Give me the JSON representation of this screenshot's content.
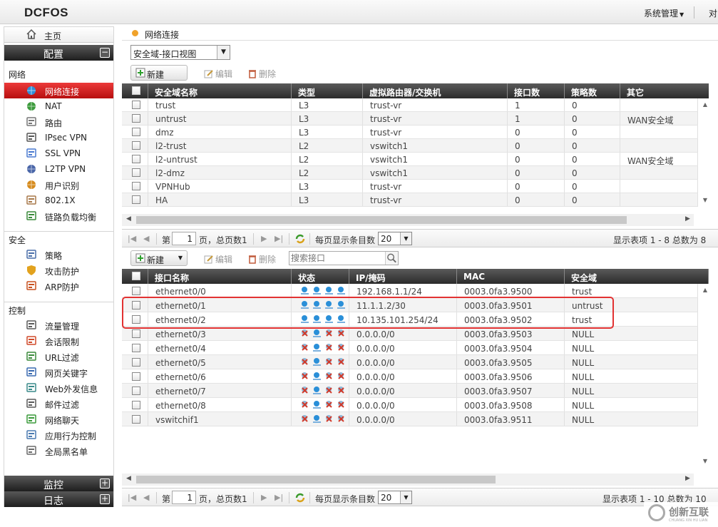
{
  "topbar": {
    "logo": "DCFOS",
    "system_menu": "系统管理",
    "truncated": "对"
  },
  "sidebar": {
    "home_label": "主页",
    "config_label": "配置",
    "config_toggle": "−",
    "sections": {
      "network": "网络",
      "security": "安全",
      "control": "控制"
    },
    "network_items": [
      {
        "label": "网络连接",
        "icon": "globe-icon"
      },
      {
        "label": "NAT",
        "icon": "nat-icon"
      },
      {
        "label": "路由",
        "icon": "route-icon"
      },
      {
        "label": "IPsec VPN",
        "icon": "ipsec-icon"
      },
      {
        "label": "SSL VPN",
        "icon": "ssl-icon"
      },
      {
        "label": "L2TP VPN",
        "icon": "l2tp-icon"
      },
      {
        "label": "用户识别",
        "icon": "user-id-icon"
      },
      {
        "label": "802.1X",
        "icon": "dot1x-icon"
      },
      {
        "label": "链路负载均衡",
        "icon": "lb-icon"
      }
    ],
    "security_items": [
      {
        "label": "策略",
        "icon": "policy-icon"
      },
      {
        "label": "攻击防护",
        "icon": "shield-icon"
      },
      {
        "label": "ARP防护",
        "icon": "arp-icon"
      }
    ],
    "control_items": [
      {
        "label": "流量管理",
        "icon": "traffic-icon"
      },
      {
        "label": "会话限制",
        "icon": "session-icon"
      },
      {
        "label": "URL过滤",
        "icon": "url-icon"
      },
      {
        "label": "网页关键字",
        "icon": "keyword-icon"
      },
      {
        "label": "Web外发信息",
        "icon": "web-out-icon"
      },
      {
        "label": "邮件过滤",
        "icon": "mail-icon"
      },
      {
        "label": "网络聊天",
        "icon": "chat-icon"
      },
      {
        "label": "应用行为控制",
        "icon": "app-icon"
      },
      {
        "label": "全局黑名单",
        "icon": "blacklist-icon"
      }
    ],
    "monitor_label": "监控",
    "log_label": "日志",
    "expand_symbol": "+"
  },
  "breadcrumb": {
    "label": "网络连接"
  },
  "view_select": {
    "value": "安全域-接口视图"
  },
  "zone_toolbar": {
    "new_label": "新建",
    "edit_label": "编辑",
    "delete_label": "删除"
  },
  "zone_table": {
    "headers": [
      "安全域名称",
      "类型",
      "虚拟路由器/交换机",
      "接口数",
      "策略数",
      "其它"
    ],
    "rows": [
      [
        "trust",
        "L3",
        "trust-vr",
        "1",
        "0",
        ""
      ],
      [
        "untrust",
        "L3",
        "trust-vr",
        "1",
        "0",
        "WAN安全域"
      ],
      [
        "dmz",
        "L3",
        "trust-vr",
        "0",
        "0",
        ""
      ],
      [
        "l2-trust",
        "L2",
        "vswitch1",
        "0",
        "0",
        ""
      ],
      [
        "l2-untrust",
        "L2",
        "vswitch1",
        "0",
        "0",
        "WAN安全域"
      ],
      [
        "l2-dmz",
        "L2",
        "vswitch1",
        "0",
        "0",
        ""
      ],
      [
        "VPNHub",
        "L3",
        "trust-vr",
        "0",
        "0",
        ""
      ],
      [
        "HA",
        "L3",
        "trust-vr",
        "0",
        "0",
        ""
      ]
    ]
  },
  "pager1": {
    "page_prefix": "第",
    "page_value": "1",
    "page_suffix": "页，总页数1",
    "per_page_label": "每页显示条目数",
    "per_page_value": "20",
    "info": "显示表项 1 - 8 总数为 8"
  },
  "iface_toolbar": {
    "new_label": "新建",
    "edit_label": "编辑",
    "delete_label": "删除",
    "search_placeholder": "搜索接口"
  },
  "iface_table": {
    "headers": [
      "接口名称",
      "状态",
      "IP/掩码",
      "MAC",
      "安全域"
    ],
    "rows": [
      {
        "name": "ethernet0/0",
        "status": [
          "up",
          "up",
          "up",
          "up"
        ],
        "ip": "192.168.1.1/24",
        "mac": "0003.0fa3.9500",
        "zone": "trust"
      },
      {
        "name": "ethernet0/1",
        "status": [
          "up",
          "up",
          "up",
          "up"
        ],
        "ip": "11.1.1.2/30",
        "mac": "0003.0fa3.9501",
        "zone": "untrust"
      },
      {
        "name": "ethernet0/2",
        "status": [
          "up",
          "up",
          "up",
          "up"
        ],
        "ip": "10.135.101.254/24",
        "mac": "0003.0fa3.9502",
        "zone": "trust"
      },
      {
        "name": "ethernet0/3",
        "status": [
          "down",
          "up",
          "down",
          "down"
        ],
        "ip": "0.0.0.0/0",
        "mac": "0003.0fa3.9503",
        "zone": "NULL"
      },
      {
        "name": "ethernet0/4",
        "status": [
          "down",
          "up",
          "down",
          "down"
        ],
        "ip": "0.0.0.0/0",
        "mac": "0003.0fa3.9504",
        "zone": "NULL"
      },
      {
        "name": "ethernet0/5",
        "status": [
          "down",
          "up",
          "down",
          "down"
        ],
        "ip": "0.0.0.0/0",
        "mac": "0003.0fa3.9505",
        "zone": "NULL"
      },
      {
        "name": "ethernet0/6",
        "status": [
          "down",
          "up",
          "down",
          "down"
        ],
        "ip": "0.0.0.0/0",
        "mac": "0003.0fa3.9506",
        "zone": "NULL"
      },
      {
        "name": "ethernet0/7",
        "status": [
          "down",
          "up",
          "down",
          "down"
        ],
        "ip": "0.0.0.0/0",
        "mac": "0003.0fa3.9507",
        "zone": "NULL"
      },
      {
        "name": "ethernet0/8",
        "status": [
          "down",
          "up",
          "down",
          "down"
        ],
        "ip": "0.0.0.0/0",
        "mac": "0003.0fa3.9508",
        "zone": "NULL"
      },
      {
        "name": "vswitchif1",
        "status": [
          "down",
          "up",
          "down",
          "down"
        ],
        "ip": "0.0.0.0/0",
        "mac": "0003.0fa3.9511",
        "zone": "NULL"
      }
    ]
  },
  "pager2": {
    "page_prefix": "第",
    "page_value": "1",
    "page_suffix": "页，总页数1",
    "per_page_label": "每页显示条目数",
    "per_page_value": "20",
    "info": "显示表项 1 - 10 总数为 10"
  },
  "watermark": {
    "text": "创新互联",
    "sub": "CHUANG XIN HU LIAN"
  },
  "colors": {
    "active_red": "#c8161d",
    "header_dark": "#333333",
    "status_up": "#2a8fd8",
    "status_down": "#d23a2a",
    "highlight": "#e23232"
  }
}
